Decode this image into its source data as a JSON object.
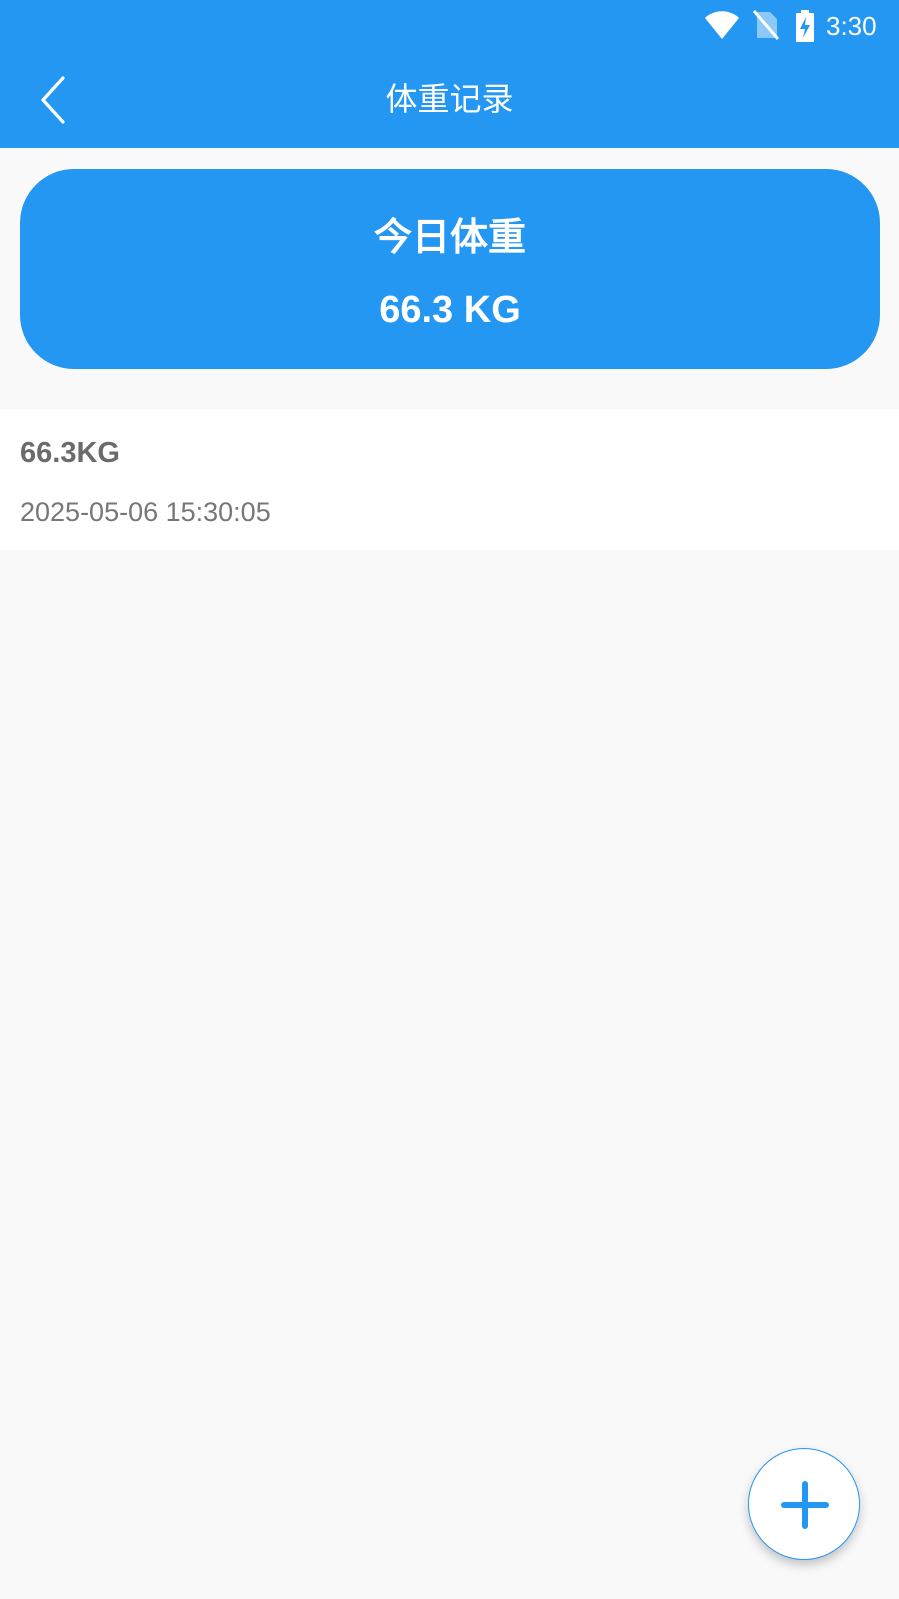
{
  "status_bar": {
    "time": "3:30",
    "icons": [
      "wifi-icon",
      "no-sim-icon",
      "battery-charging-icon"
    ]
  },
  "header": {
    "title": "体重记录",
    "back_icon": "chevron-left-icon"
  },
  "today_card": {
    "label": "今日体重",
    "value": "66.3 KG"
  },
  "records": [
    {
      "weight": "66.3KG",
      "time": "2025-05-06 15:30:05"
    }
  ],
  "fab": {
    "icon": "plus-icon"
  },
  "colors": {
    "primary": "#2497f3",
    "background": "#f9f9fa",
    "card": "#ffffff",
    "text_secondary": "#777777"
  }
}
